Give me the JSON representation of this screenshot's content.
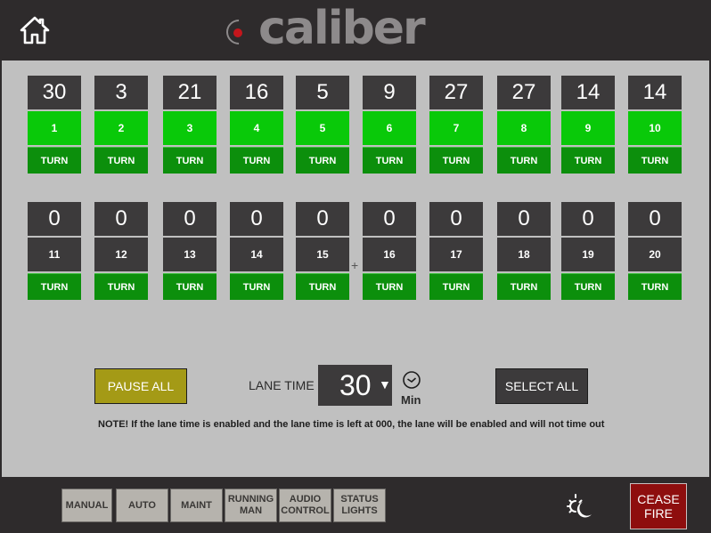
{
  "header": {
    "logo_text": "caliber"
  },
  "lanes": [
    {
      "time": "30",
      "number": "1",
      "turn": "TURN",
      "active": true
    },
    {
      "time": "3",
      "number": "2",
      "turn": "TURN",
      "active": true
    },
    {
      "time": "21",
      "number": "3",
      "turn": "TURN",
      "active": true
    },
    {
      "time": "16",
      "number": "4",
      "turn": "TURN",
      "active": true
    },
    {
      "time": "5",
      "number": "5",
      "turn": "TURN",
      "active": true
    },
    {
      "time": "9",
      "number": "6",
      "turn": "TURN",
      "active": true
    },
    {
      "time": "27",
      "number": "7",
      "turn": "TURN",
      "active": true
    },
    {
      "time": "27",
      "number": "8",
      "turn": "TURN",
      "active": true
    },
    {
      "time": "14",
      "number": "9",
      "turn": "TURN",
      "active": true
    },
    {
      "time": "14",
      "number": "10",
      "turn": "TURN",
      "active": true
    },
    {
      "time": "0",
      "number": "11",
      "turn": "TURN",
      "active": false
    },
    {
      "time": "0",
      "number": "12",
      "turn": "TURN",
      "active": false
    },
    {
      "time": "0",
      "number": "13",
      "turn": "TURN",
      "active": false
    },
    {
      "time": "0",
      "number": "14",
      "turn": "TURN",
      "active": false
    },
    {
      "time": "0",
      "number": "15",
      "turn": "TURN",
      "active": false
    },
    {
      "time": "0",
      "number": "16",
      "turn": "TURN",
      "active": false
    },
    {
      "time": "0",
      "number": "17",
      "turn": "TURN",
      "active": false
    },
    {
      "time": "0",
      "number": "18",
      "turn": "TURN",
      "active": false
    },
    {
      "time": "0",
      "number": "19",
      "turn": "TURN",
      "active": false
    },
    {
      "time": "0",
      "number": "20",
      "turn": "TURN",
      "active": false
    }
  ],
  "controls": {
    "pause_all": "PAUSE ALL",
    "lane_time_label": "LANE TIME",
    "lane_time_value": "30",
    "min_label": "Min",
    "select_all": "SELECT ALL",
    "note": "NOTE! If the lane time is enabled and the lane time is left at 000, the lane will be enabled and will not time out"
  },
  "footer": {
    "manual": "MANUAL",
    "auto": "AUTO",
    "maint": "MAINT",
    "running_man_1": "RUNNING",
    "running_man_2": "MAN",
    "audio_control_1": "AUDIO",
    "audio_control_2": "CONTROL",
    "status_lights_1": "STATUS",
    "status_lights_2": "LIGHTS",
    "cease_fire_1": "CEASE",
    "cease_fire_2": "FIRE"
  },
  "colors": {
    "active_lane": "#09c909",
    "turn_button": "#0c8f0c",
    "inactive_lane": "#3c3a3b",
    "pause_button": "#a49a16",
    "cease_fire": "#8e0e0e"
  }
}
